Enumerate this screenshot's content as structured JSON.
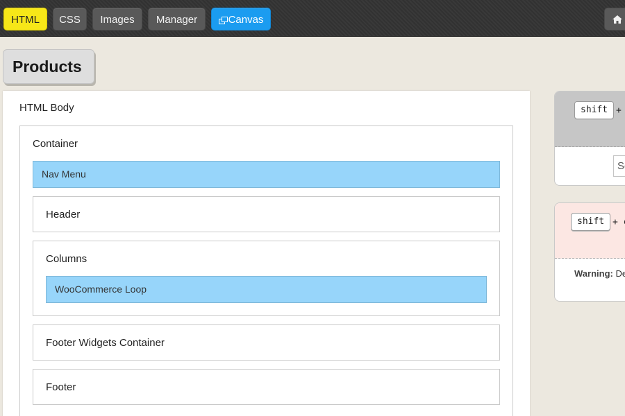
{
  "toolbar": {
    "tabs": [
      {
        "label": "HTML",
        "active": true
      },
      {
        "label": "CSS",
        "active": false
      },
      {
        "label": "Images",
        "active": false
      },
      {
        "label": "Manager",
        "active": false
      }
    ],
    "canvas_label": "Canvas",
    "colors": {
      "active": "#f7e718",
      "canvas": "#1b9cf0",
      "default": "#595959"
    }
  },
  "page": {
    "title": "Products"
  },
  "tree": {
    "root": "HTML Body",
    "container": "Container",
    "nav_menu": "Nav Menu",
    "header": "Header",
    "columns": "Columns",
    "woocommerce_loop": "WooCommerce Loop",
    "footer_widgets": "Footer Widgets Container",
    "footer": "Footer"
  },
  "right_cards": {
    "card1": {
      "key": "shift",
      "plus": "+",
      "search_fragment": "Se"
    },
    "card2": {
      "key": "shift",
      "plus": "+ c",
      "warning_label": "Warning:",
      "warning_fragment": "De"
    }
  }
}
